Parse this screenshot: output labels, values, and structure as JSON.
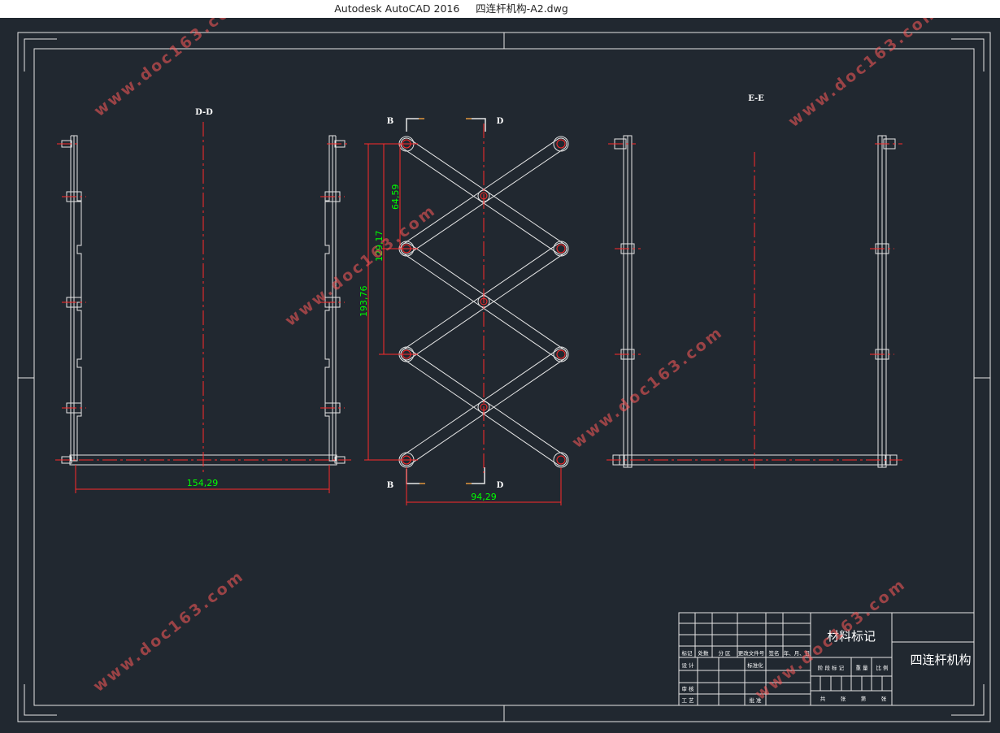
{
  "window": {
    "title": "Autodesk AutoCAD 2016     四连杆机构-A2.dwg"
  },
  "views": {
    "left_label": "D-D",
    "right_label": "E-E",
    "section_marks": {
      "b_top": "B",
      "d_top": "D",
      "b_bottom": "B",
      "d_bottom": "D"
    }
  },
  "dimensions": {
    "left_width": "154,29",
    "middle_width": "94,29",
    "h1": "64,59",
    "h2": "129,17",
    "h3": "193,76"
  },
  "title_block": {
    "material": "材料标记",
    "part_name": "四连杆机构",
    "header_cells": [
      "标记",
      "处数",
      "分 区",
      "更改文件号",
      "签名",
      "年、月、日"
    ],
    "row_labels": [
      "设 计",
      "审 核",
      "工 艺"
    ],
    "mid_labels": [
      "标准化",
      "批 准"
    ],
    "stage_cells": [
      "阶 段 标 记",
      "重 量",
      "比 例"
    ],
    "bottom_cells": [
      "共",
      "张",
      "第",
      "张"
    ]
  },
  "watermark": "www.doc163.com",
  "colors": {
    "background": "#212830",
    "line": "#e6e6e6",
    "center": "#ff2a2a",
    "dimension": "#00ff00"
  }
}
